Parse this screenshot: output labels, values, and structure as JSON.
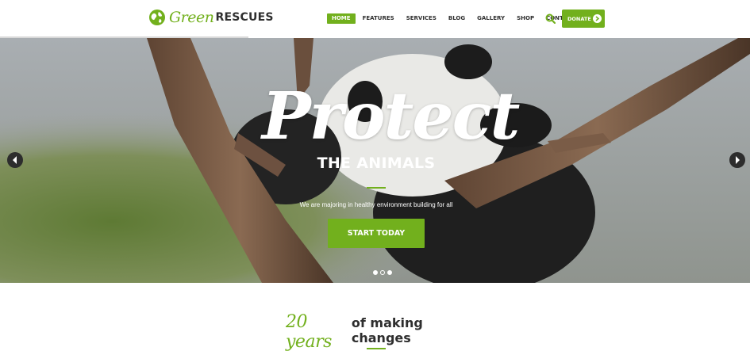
{
  "brand": {
    "logo_green": "Green",
    "logo_rescues": "RESCUES",
    "accent_color": "#72b01d"
  },
  "nav": {
    "items": [
      {
        "label": "HOME",
        "active": true
      },
      {
        "label": "FEATURES",
        "active": false
      },
      {
        "label": "SERVICES",
        "active": false
      },
      {
        "label": "BLOG",
        "active": false
      },
      {
        "label": "GALLERY",
        "active": false
      },
      {
        "label": "SHOP",
        "active": false
      },
      {
        "label": "CONTACTS",
        "active": false
      }
    ],
    "search_icon": "search-icon",
    "donate_label": "DONATE"
  },
  "hero": {
    "title": "Protect",
    "subtitle": "THE ANIMALS",
    "tagline": "We are majoring in healthy environment building for all",
    "cta_label": "START TODAY",
    "slides": 3,
    "active_slide": 1
  },
  "section": {
    "years": "20 years",
    "text": "of making changes"
  }
}
